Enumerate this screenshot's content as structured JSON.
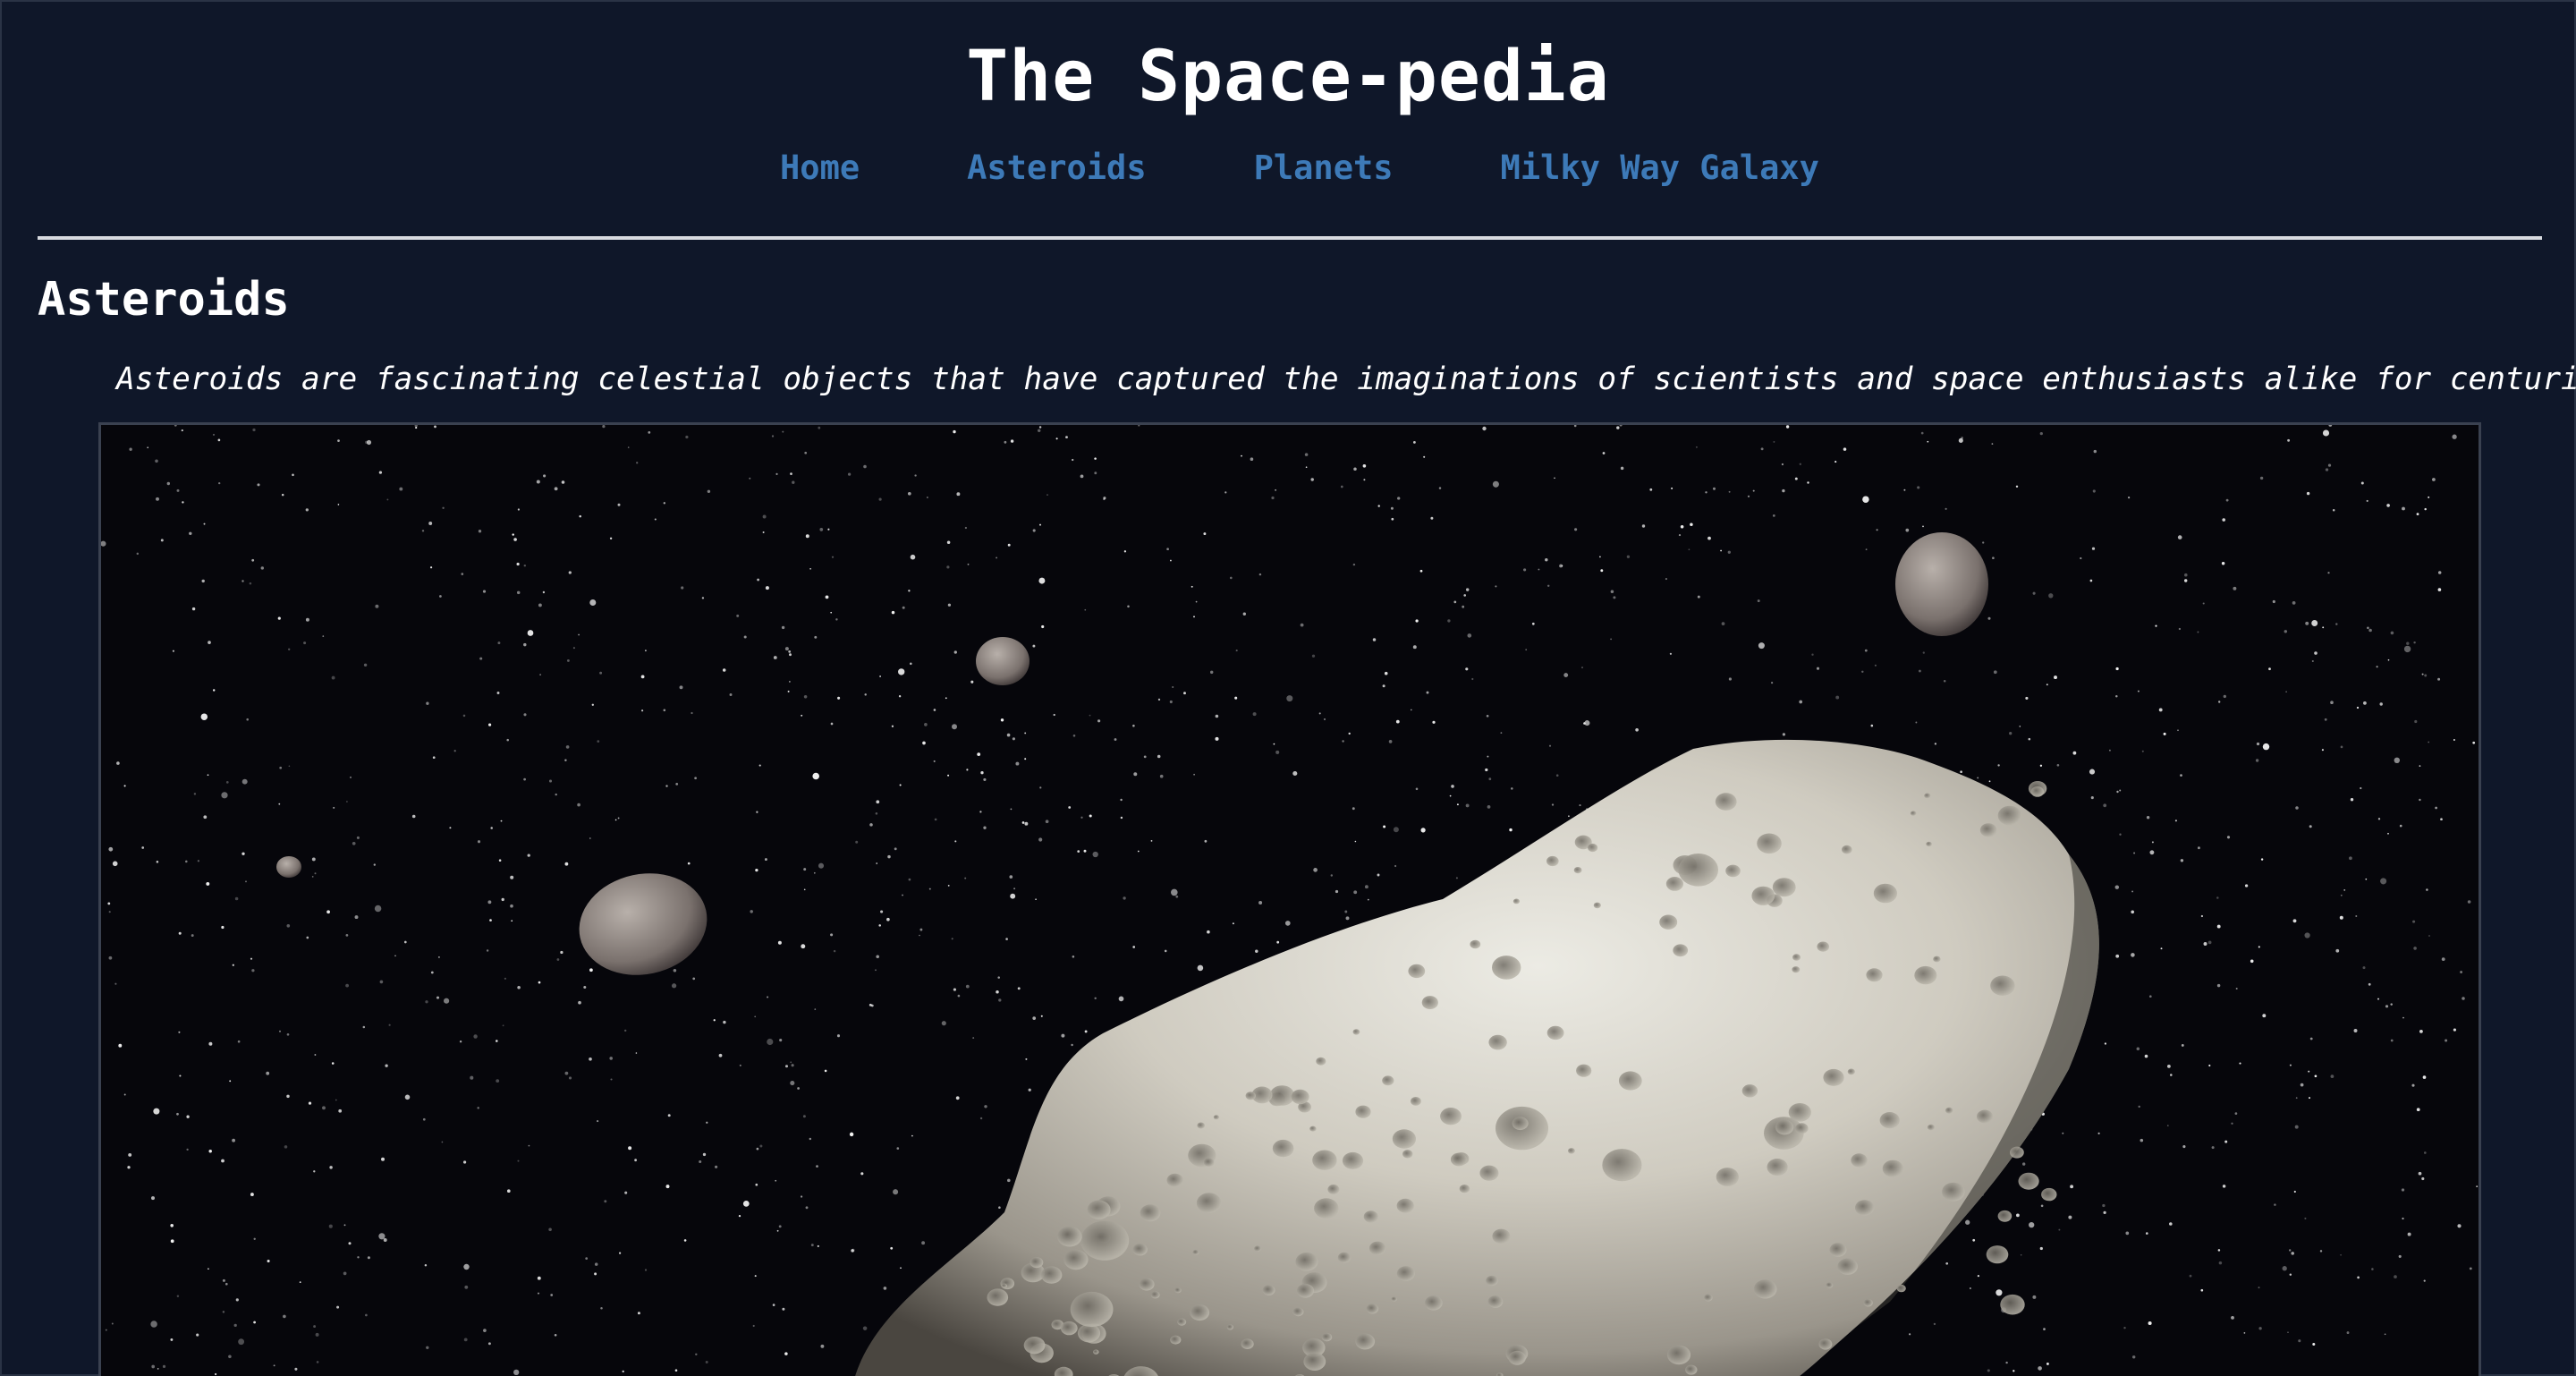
{
  "site": {
    "title": "The Space-pedia"
  },
  "nav": {
    "items": [
      {
        "label": "Home"
      },
      {
        "label": "Asteroids"
      },
      {
        "label": "Planets"
      },
      {
        "label": "Milky Way Galaxy"
      }
    ]
  },
  "main": {
    "heading": "Asteroids",
    "intro": "Asteroids are fascinating celestial objects that have captured the imaginations of scientists and space enthusiasts alike for centuries."
  },
  "colors": {
    "background": "#0f1729",
    "nav_link": "#3d7ab8",
    "text": "#ffffff"
  }
}
